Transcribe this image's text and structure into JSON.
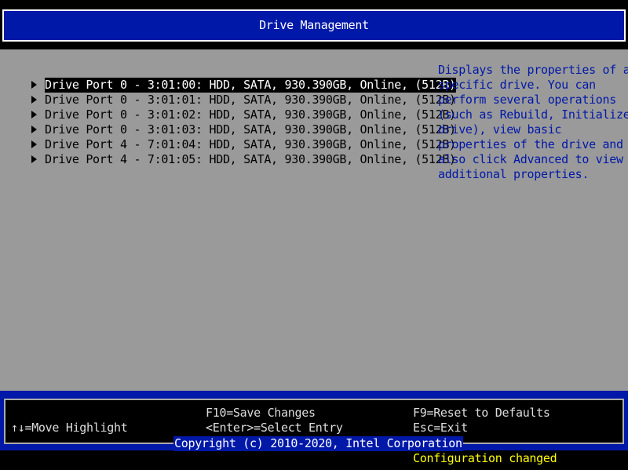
{
  "header": {
    "title": "Drive Management"
  },
  "drives": [
    {
      "label": "Drive Port 0 - 3:01:00: HDD, SATA, 930.390GB, Online, (512B)",
      "selected": true
    },
    {
      "label": "Drive Port 0 - 3:01:01: HDD, SATA, 930.390GB, Online, (512B)",
      "selected": false
    },
    {
      "label": "Drive Port 0 - 3:01:02: HDD, SATA, 930.390GB, Online, (512B)",
      "selected": false
    },
    {
      "label": "Drive Port 0 - 3:01:03: HDD, SATA, 930.390GB, Online, (512B)",
      "selected": false
    },
    {
      "label": "Drive Port 4 - 7:01:04: HDD, SATA, 930.390GB, Online, (512B)",
      "selected": false
    },
    {
      "label": "Drive Port 4 - 7:01:05: HDD, SATA, 930.390GB, Online, (512B)",
      "selected": false
    }
  ],
  "help": {
    "lines": [
      "Displays the properties of a",
      "specific drive. You can",
      "perform several operations",
      "(such as Rebuild, Initialize",
      "drive), view basic",
      "properties of the drive and",
      "also click Advanced to view",
      "additional properties."
    ]
  },
  "footer": {
    "move_highlight": "↑↓=Move Highlight",
    "save_changes": "F10=Save Changes",
    "select_entry": "<Enter>=Select Entry",
    "reset_defaults": "F9=Reset to Defaults",
    "exit": "Esc=Exit",
    "copyright": "Copyright (c) 2010-2020, Intel Corporation",
    "status": "Configuration changed"
  },
  "colors": {
    "background": "#9a9a9a",
    "bios_blue": "#0018a8",
    "help_text": "#0018a8",
    "status_yellow": "#ffff00"
  }
}
